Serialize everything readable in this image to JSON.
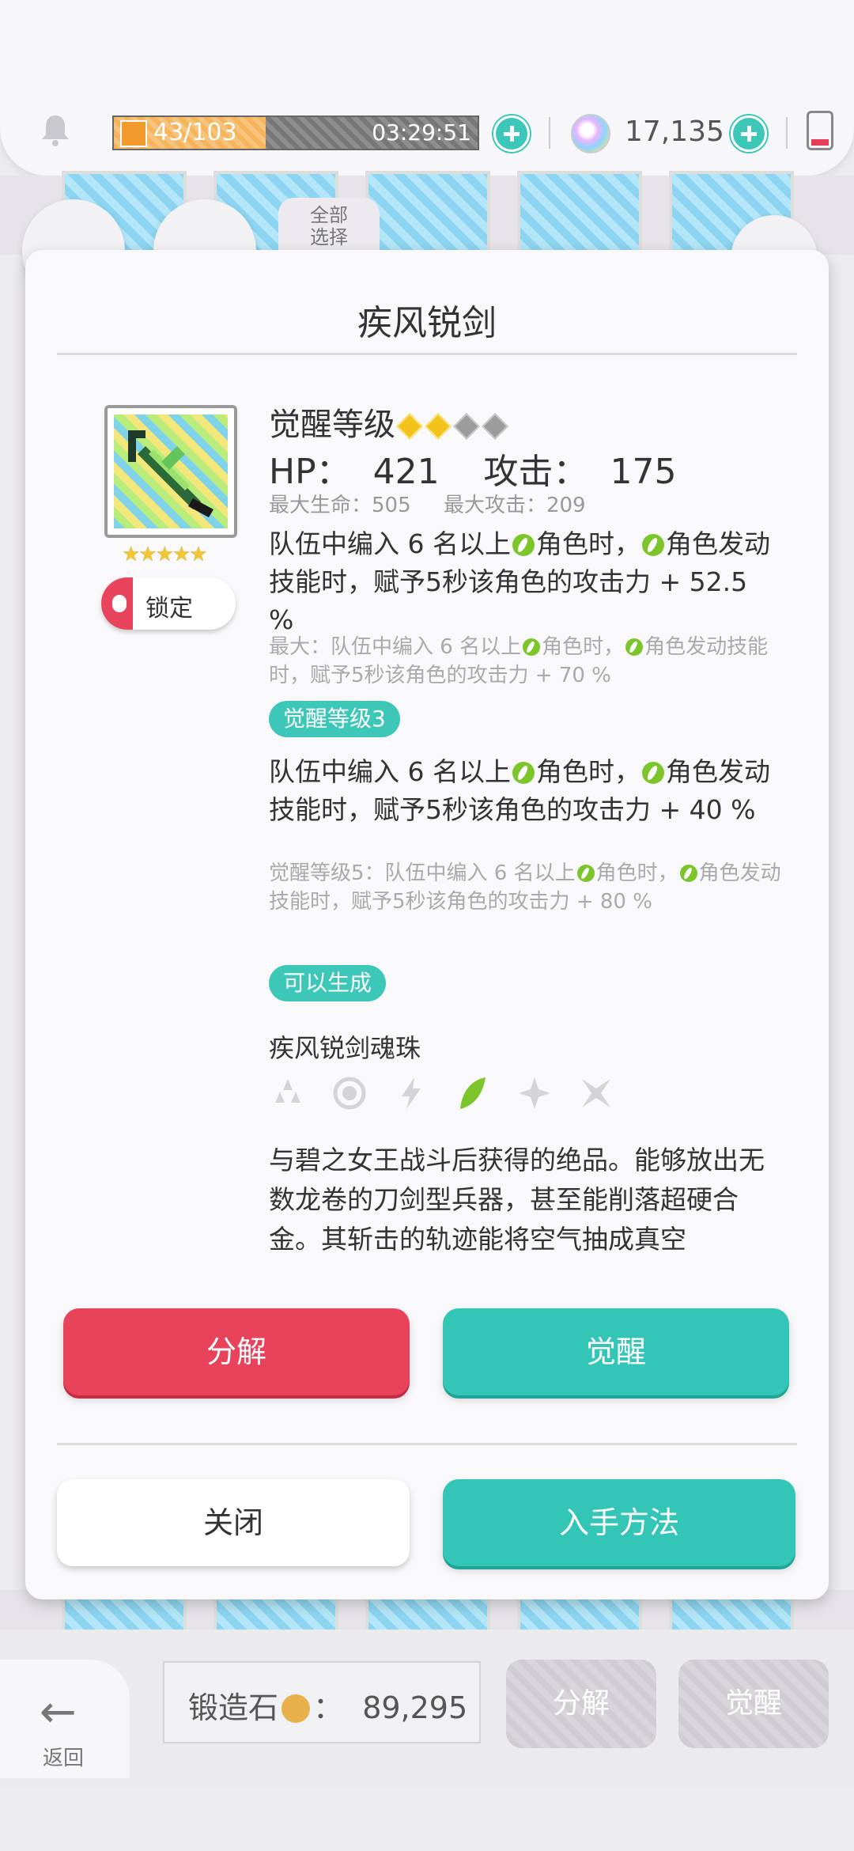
{
  "status": {
    "stamina_text": "43/103",
    "stamina_fraction": 0.417,
    "timer": "03:29:51",
    "gems": "17,135"
  },
  "background": {
    "select_all_line1": "全部",
    "select_all_line2": "选择"
  },
  "dialog": {
    "title": "疾风锐剑",
    "lock_label": "锁定",
    "stars": "★★★★★",
    "awakening_label": "觉醒等级",
    "awakening_level": 2,
    "awakening_max": 4,
    "stats_line": "HP：  421    攻击：  175",
    "max_stats_line": "最大生命：505     最大攻击：209",
    "skill_current": {
      "part1": "队伍中编入 6 名以上",
      "part2": "角色时，",
      "part3": "角色发动技能时，赋予5秒该角色的攻击力 + 52.5 %"
    },
    "skill_max": {
      "part1": "最大：队伍中编入 6 名以上",
      "part2": "角色时，",
      "part3": "角色发动技能时，赋予5秒该角色的攻击力 + 70 %"
    },
    "awaken3_pill": "觉醒等级3",
    "skill_aw3": {
      "part1": "队伍中编入 6 名以上",
      "part2": "角色时，",
      "part3": "角色发动技能时，赋予5秒该角色的攻击力 + 40 %"
    },
    "skill_aw5": {
      "part1": "觉醒等级5：队伍中编入 6 名以上",
      "part2": "角色时，",
      "part3": "角色发动技能时，赋予5秒该角色的攻击力 + 80 %"
    },
    "craftable_pill": "可以生成",
    "orb_name": "疾风锐剑魂珠",
    "orb_icons": [
      "earth-drops-icon",
      "ring-icon",
      "lightning-icon",
      "wind-leaf-icon",
      "sparkle-icon",
      "shuriken-icon"
    ],
    "orb_active_index": 3,
    "description": "与碧之女王战斗后获得的绝品。能够放出无数龙卷的刀剑型兵器，甚至能削落超硬合金。其斩击的轨迹能将空气抽成真空",
    "btn_dismantle": "分解",
    "btn_awaken": "觉醒",
    "btn_close": "关闭",
    "btn_obtain": "入手方法"
  },
  "bottom": {
    "back_label": "返回",
    "forge_label": "锻造石",
    "forge_count": "89,295",
    "btn_dismantle": "分解",
    "btn_awaken": "觉醒"
  },
  "colors": {
    "teal": "#33c6b6",
    "red": "#e9425b",
    "wind": "#7cc62c",
    "gold": "#f3c21b"
  }
}
